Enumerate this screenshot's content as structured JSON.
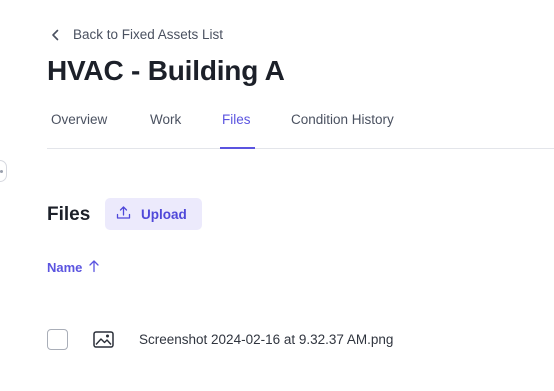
{
  "nav": {
    "back_label": "Back to Fixed Assets List"
  },
  "header": {
    "title": "HVAC - Building A"
  },
  "tabs": [
    {
      "label": "Overview",
      "active": false
    },
    {
      "label": "Work",
      "active": false
    },
    {
      "label": "Files",
      "active": true
    },
    {
      "label": "Condition History",
      "active": false
    }
  ],
  "files": {
    "heading": "Files",
    "upload_label": "Upload",
    "sort_column": "Name",
    "sort_direction": "ascending",
    "items": [
      {
        "name": "Screenshot 2024-02-16 at 9.32.37 AM.png",
        "type_icon": "image-icon",
        "selected": false
      }
    ]
  },
  "colors": {
    "accent": "#5b54e0",
    "upload_bg": "#eceafc"
  }
}
